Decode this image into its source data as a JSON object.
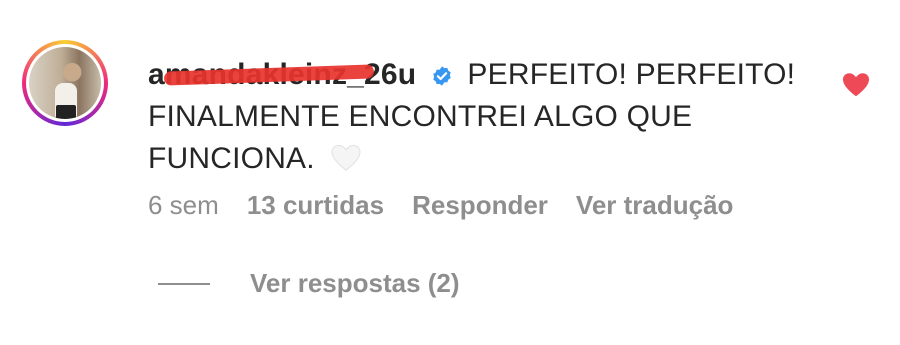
{
  "comment": {
    "username": "amandakleinz_26u",
    "verified": true,
    "text": "PERFEITO! PERFEITO! FINALMENTE ENCONTREI ALGO QUE FUNCIONA.",
    "emoji_icon": "white-heart-icon",
    "liked": true,
    "like_color": "#ed4956"
  },
  "meta": {
    "time": "6 sem",
    "likes": "13 curtidas",
    "reply_label": "Responder",
    "translate_label": "Ver tradução"
  },
  "replies": {
    "label": "Ver respostas (2)"
  }
}
